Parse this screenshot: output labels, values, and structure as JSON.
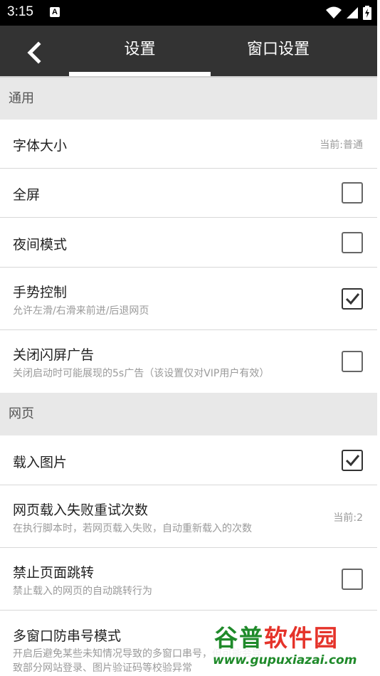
{
  "status_bar": {
    "time": "3:15",
    "notification_letter": "A"
  },
  "header": {
    "back_icon": "chevron-left-icon",
    "tabs": [
      {
        "label": "设置",
        "active": true
      },
      {
        "label": "窗口设置",
        "active": false
      }
    ]
  },
  "sections": {
    "general": {
      "title": "通用",
      "items": [
        {
          "title": "字体大小",
          "value": "当前:普通"
        },
        {
          "title": "全屏",
          "checked": false
        },
        {
          "title": "夜间模式",
          "checked": false
        },
        {
          "title": "手势控制",
          "subtitle": "允许左滑/右滑来前进/后退网页",
          "checked": true
        },
        {
          "title": "关闭闪屏广告",
          "subtitle": "关闭启动时可能展现的5s广告（该设置仅对VIP用户有效）",
          "checked": false
        }
      ]
    },
    "webpage": {
      "title": "网页",
      "items": [
        {
          "title": "载入图片",
          "checked": true
        },
        {
          "title": "网页载入失败重试次数",
          "subtitle": "在执行脚本时，若网页载入失败，自动重新载入的次数",
          "value": "当前:2"
        },
        {
          "title": "禁止页面跳转",
          "subtitle": "禁止载入的网页的自动跳转行为",
          "checked": false
        },
        {
          "title": "多窗口防串号模式",
          "subtitle": "开启后避免某些未知情况导致的多窗口串号，但可能会导",
          "subtitle2": "致部分网站登录、图片验证码等校验异常"
        }
      ]
    }
  },
  "watermark": {
    "brand_left": "谷普",
    "brand_right": "软件园",
    "url": "www.gupuxiazai.com"
  },
  "colors": {
    "header_bg": "#333333",
    "section_bg": "#e8e8e8",
    "watermark_green": "#1f8a2a",
    "watermark_red": "#e5332a"
  }
}
